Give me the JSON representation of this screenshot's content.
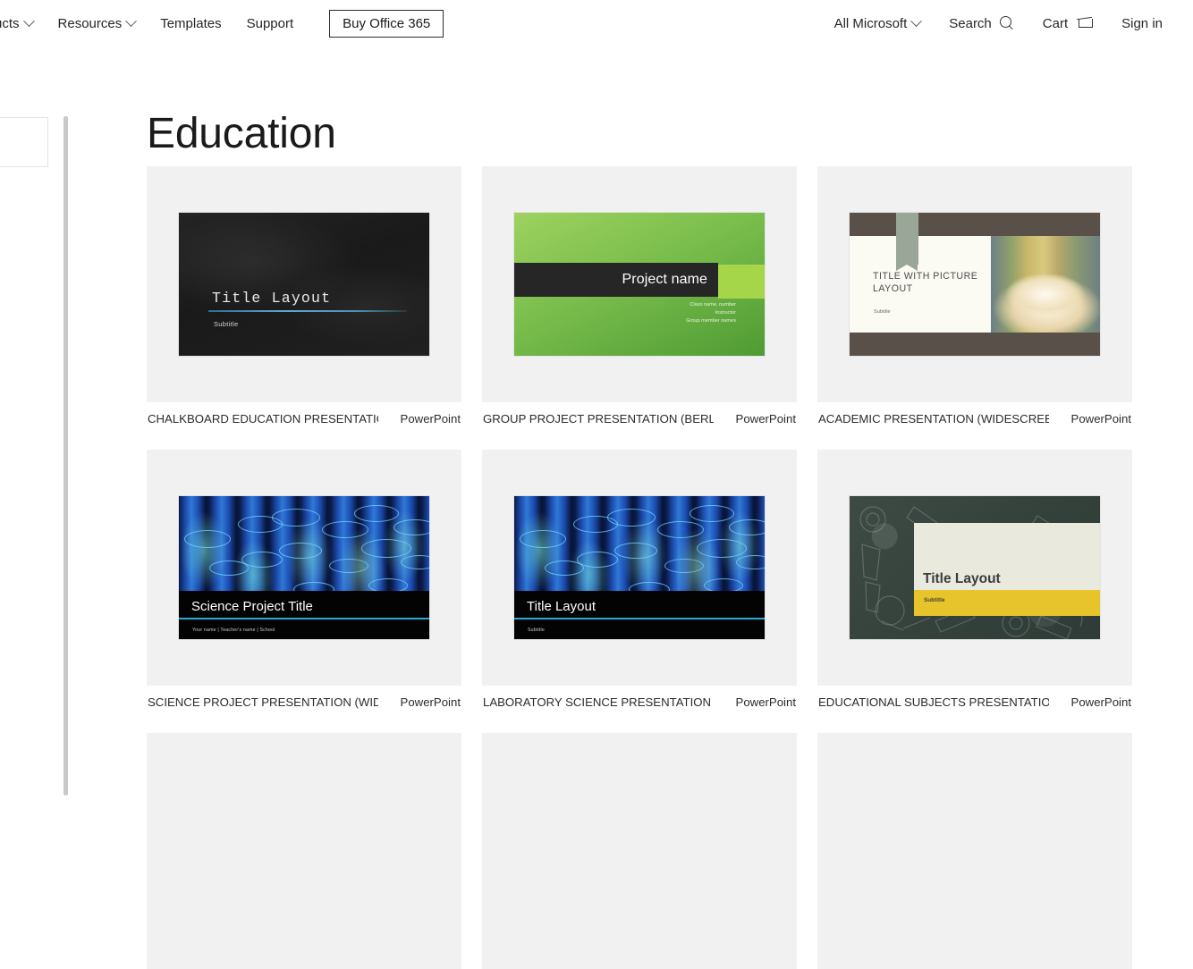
{
  "nav": {
    "left_items": [
      {
        "label": "ucts",
        "icon": "chevron-down-icon",
        "has_chevron": true
      },
      {
        "label": "Resources",
        "icon": "chevron-down-icon",
        "has_chevron": true
      },
      {
        "label": "Templates",
        "has_chevron": false
      },
      {
        "label": "Support",
        "has_chevron": false
      }
    ],
    "buy_button": "Buy Office 365",
    "right_items": [
      {
        "label": "All Microsoft",
        "icon": "chevron-down-icon"
      },
      {
        "label": "Search",
        "icon": "search-icon"
      },
      {
        "label": "Cart",
        "icon": "cart-icon"
      },
      {
        "label": "Sign in",
        "icon": ""
      }
    ]
  },
  "page": {
    "title": "Education"
  },
  "cards": [
    {
      "name": "CHALKBOARD EDUCATION PRESENTATION (...",
      "app": "PowerPoint",
      "slide": {
        "style": "chalkboard",
        "title": "Title Layout",
        "subtitle": "Subtitle"
      }
    },
    {
      "name": "GROUP PROJECT PRESENTATION (BERLIN T...",
      "app": "PowerPoint",
      "slide": {
        "style": "green-berlin",
        "title": "Project name",
        "lines": [
          "Class name, number",
          "Instructor",
          "Group member names"
        ]
      }
    },
    {
      "name": "ACADEMIC PRESENTATION (WIDESCREEN)",
      "app": "PowerPoint",
      "slide": {
        "style": "academic",
        "title": "TITLE WITH PICTURE LAYOUT",
        "subtitle": "Subtitle"
      }
    },
    {
      "name": "SCIENCE PROJECT PRESENTATION (WIDESC...",
      "app": "PowerPoint",
      "slide": {
        "style": "test-tubes",
        "title": "Science Project Title",
        "subtitle": "Your name | Teacher's name | School"
      }
    },
    {
      "name": "LABORATORY SCIENCE PRESENTATION (WID...",
      "app": "PowerPoint",
      "slide": {
        "style": "test-tubes",
        "title": "Title Layout",
        "subtitle": "Subtitle"
      }
    },
    {
      "name": "EDUCATIONAL SUBJECTS PRESENTATION, C...",
      "app": "PowerPoint",
      "slide": {
        "style": "subjects",
        "title": "Title Layout",
        "subtitle": "Subtitle"
      }
    }
  ],
  "colors": {
    "tile_bg": "#f1f1f1",
    "page_bg": "#ffffff",
    "text": "#262626",
    "chalk_accent": "#5fa8cf",
    "green_light": "#9ed25f",
    "green_dark": "#4f9b34",
    "green_chip": "#a5d64a",
    "academic_bar": "#595049",
    "academic_ribbon": "#9aa698",
    "tube_accent": "#2aa8d8",
    "subjects_yellow": "#e8c42c",
    "subjects_panel": "#e9e9de"
  }
}
